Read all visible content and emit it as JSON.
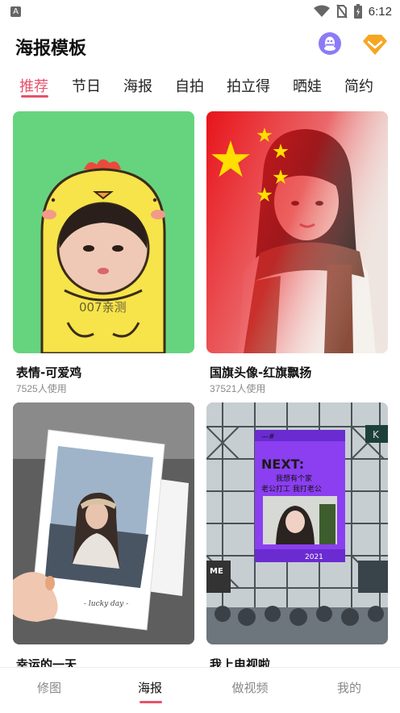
{
  "statusbar": {
    "notification_letter": "A",
    "time": "6:12"
  },
  "header": {
    "title": "海报模板"
  },
  "tabs": [
    "推荐",
    "节日",
    "海报",
    "自拍",
    "拍立得",
    "晒娃",
    "简约"
  ],
  "cards": [
    {
      "title": "表情-可爱鸡",
      "usage": "7525人使用",
      "image_text": "007亲测"
    },
    {
      "title": "国旗头像-红旗飘扬",
      "usage": "37521人使用"
    },
    {
      "title": "幸运的一天",
      "image_text": "- lucky day -"
    },
    {
      "title": "我上电视啦",
      "image_text": {
        "screen_title": "NEXT:",
        "line1": "我想有个家",
        "line2": "老公打工 我打老公",
        "year": "2021",
        "hashtag": "—#",
        "side_left": "ME",
        "side_right": "K"
      }
    }
  ],
  "bottom_nav": [
    "修图",
    "海报",
    "做视频",
    "我的"
  ],
  "colors": {
    "accent": "#e7536b",
    "chick_bg": "#66d47e",
    "chick_yellow": "#f6e44a",
    "flag_red": "#e8141b",
    "star_yellow": "#ffde00",
    "tv_purple": "#8b3ff0"
  },
  "icons": {
    "qq": "qq-icon",
    "vip": "diamond-icon"
  }
}
